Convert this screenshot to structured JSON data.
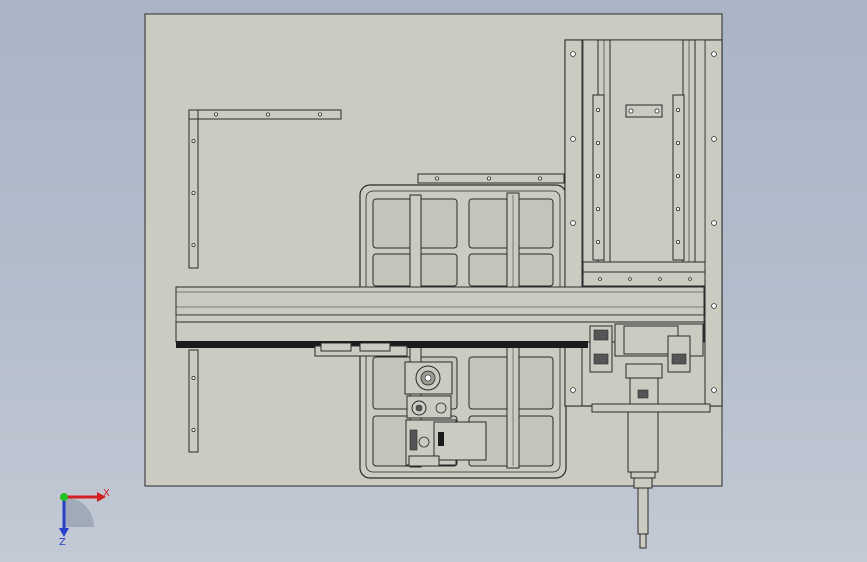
{
  "viewport": {
    "background_top": "#a9b4c5",
    "background_bottom": "#c3cad5",
    "model_face_color": "#cbcbc2",
    "edge_color": "#2a2a2a",
    "dark_band_color": "#1b1b1b"
  },
  "triad": {
    "icon": "coordinate-triad-icon",
    "x_label": "X",
    "z_label": "Z",
    "x_color": "#d42020",
    "y_color": "#22c022",
    "z_color": "#2840c8"
  }
}
